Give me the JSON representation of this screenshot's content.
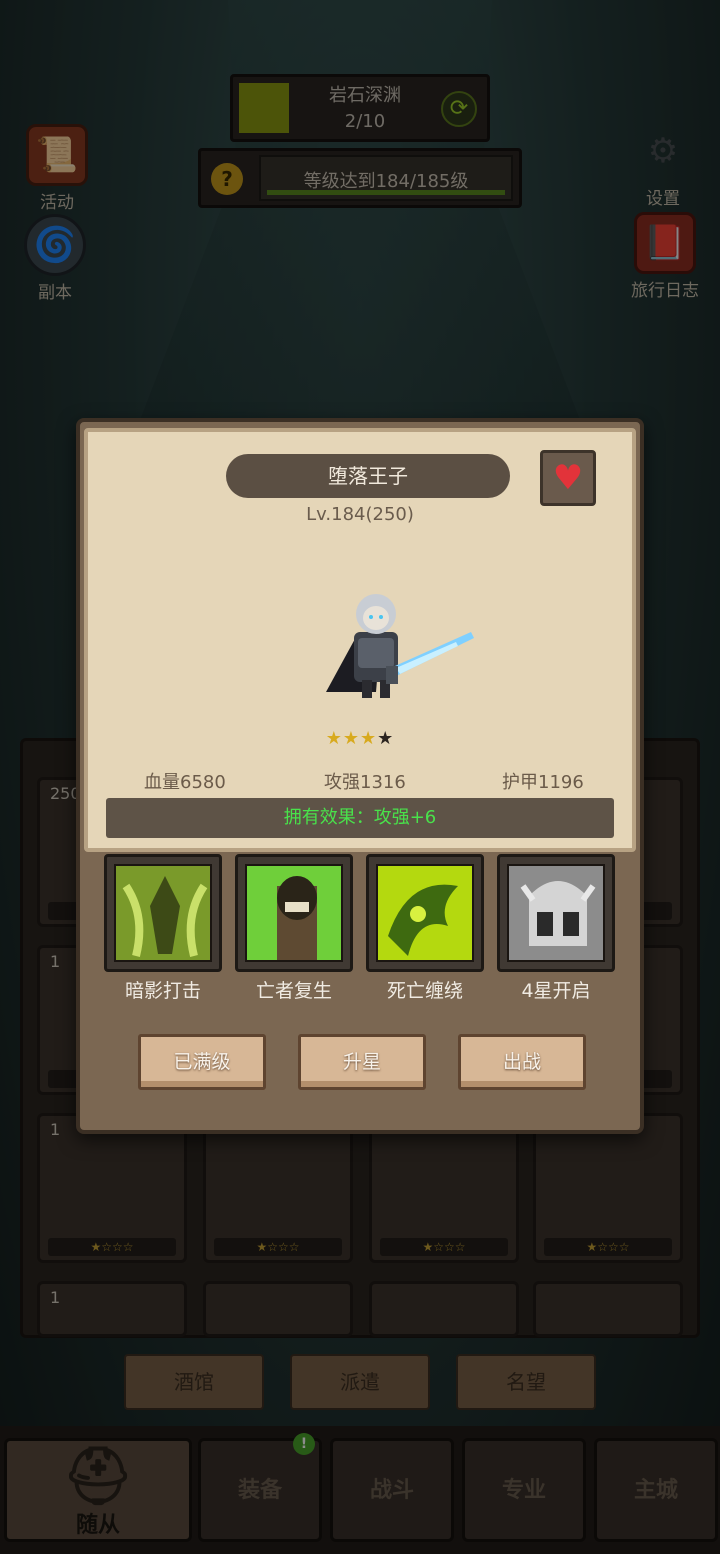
{
  "hud": {
    "stage_name": "岩石深渊",
    "stage_progress": "2/10",
    "quest_text": "等级达到184/185级",
    "refresh_icon": "refresh-icon",
    "help_icon": "question-icon"
  },
  "side_buttons": {
    "activity": "活动",
    "dungeon": "副本",
    "settings": "设置",
    "journal": "旅行日志"
  },
  "modal": {
    "hero_name": "堕落王子",
    "level": "Lv.184(250)",
    "stars_filled": 3,
    "stars_total": 4,
    "stats": {
      "hp": "血量6580",
      "attack": "攻强1316",
      "armor": "护甲1196"
    },
    "effect": "拥有效果：攻强+6",
    "skills": [
      {
        "label": "暗影打击",
        "color": "#7a9a2a"
      },
      {
        "label": "亡者复生",
        "color": "#6fcf3a"
      },
      {
        "label": "死亡缠绕",
        "color": "#b4d90f"
      },
      {
        "label": "4星开启",
        "color": "#8c8c8c"
      }
    ],
    "buttons": {
      "maxed": "已满级",
      "star_up": "升星",
      "deploy": "出战"
    }
  },
  "grid": {
    "row1_level": "250",
    "row2_level": "1",
    "row3_level": "1",
    "row4_level": "1"
  },
  "sub_tabs": {
    "tavern": "酒馆",
    "dispatch": "派遣",
    "reputation": "名望"
  },
  "bottom_nav": {
    "followers": "随从",
    "equipment": "装备",
    "battle": "战斗",
    "profession": "专业",
    "city": "主城"
  },
  "colors": {
    "effect_text": "#49e24b",
    "heart": "#e2333a",
    "star": "#d8aa1e"
  }
}
